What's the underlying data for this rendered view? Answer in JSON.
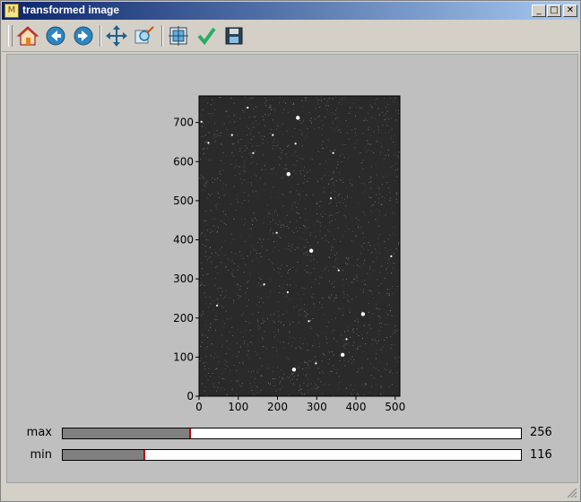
{
  "window": {
    "title": "transformed image",
    "app_icon": "matplotlib-icon"
  },
  "window_controls": [
    {
      "name": "minimize-button",
      "glyph": "_"
    },
    {
      "name": "maximize-button",
      "glyph": "□"
    },
    {
      "name": "close-button",
      "glyph": "✕"
    }
  ],
  "toolbar": {
    "buttons": [
      {
        "name": "home-button",
        "icon": "home-icon"
      },
      {
        "name": "back-button",
        "icon": "back-arrow-icon"
      },
      {
        "name": "forward-button",
        "icon": "forward-arrow-icon"
      },
      {
        "name": "pan-button",
        "icon": "move-icon"
      },
      {
        "name": "zoom-button",
        "icon": "zoom-rect-icon"
      },
      {
        "name": "configure-subplots-button",
        "icon": "subplots-icon"
      },
      {
        "name": "edit-parameters-button",
        "icon": "checkmark-icon"
      },
      {
        "name": "save-button",
        "icon": "floppy-disk-icon"
      }
    ]
  },
  "chart_data": {
    "type": "image",
    "title": "",
    "xlabel": "",
    "ylabel": "",
    "xlim": [
      0,
      512
    ],
    "ylim": [
      0,
      768
    ],
    "xticks": [
      "0",
      "100",
      "200",
      "300",
      "400",
      "500"
    ],
    "yticks": [
      "0",
      "100",
      "200",
      "300",
      "400",
      "500",
      "600",
      "700"
    ],
    "colormap": "gray",
    "background_color": "#2a2a2a",
    "bright_stars": [
      {
        "x": 252,
        "y": 712
      },
      {
        "x": 228,
        "y": 568
      },
      {
        "x": 286,
        "y": 372
      },
      {
        "x": 418,
        "y": 210
      },
      {
        "x": 366,
        "y": 106
      },
      {
        "x": 242,
        "y": 68
      },
      {
        "x": 298,
        "y": 84
      },
      {
        "x": 198,
        "y": 418
      },
      {
        "x": 188,
        "y": 668
      },
      {
        "x": 84,
        "y": 668
      },
      {
        "x": 138,
        "y": 622
      },
      {
        "x": 24,
        "y": 648
      },
      {
        "x": 342,
        "y": 622
      },
      {
        "x": 336,
        "y": 506
      },
      {
        "x": 490,
        "y": 358
      },
      {
        "x": 280,
        "y": 192
      },
      {
        "x": 376,
        "y": 146
      },
      {
        "x": 356,
        "y": 322
      },
      {
        "x": 6,
        "y": 702
      },
      {
        "x": 246,
        "y": 646
      },
      {
        "x": 124,
        "y": 738
      },
      {
        "x": 166,
        "y": 286
      },
      {
        "x": 226,
        "y": 266
      },
      {
        "x": 46,
        "y": 232
      }
    ]
  },
  "sliders": [
    {
      "label": "max",
      "value": "256",
      "fraction": 0.28
    },
    {
      "label": "min",
      "value": "116",
      "fraction": 0.18
    }
  ]
}
